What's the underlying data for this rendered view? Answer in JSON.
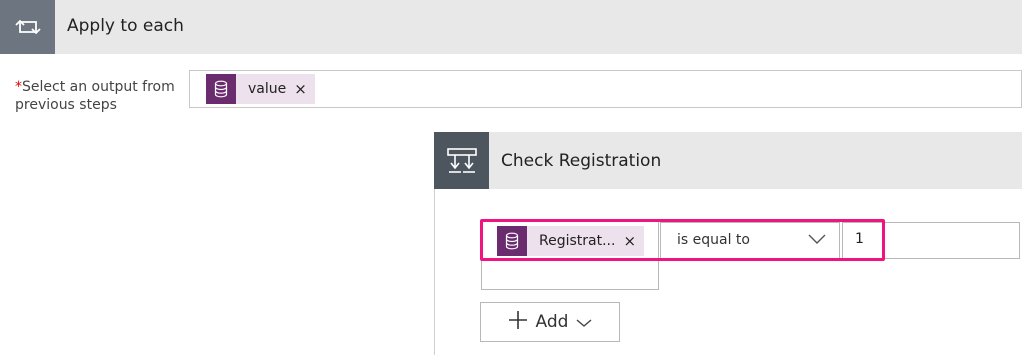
{
  "apply_to_each": {
    "title": "Apply to each",
    "icon": "loop-icon"
  },
  "output": {
    "required_mark": "*",
    "label": "Select an output from previous steps",
    "token": {
      "label": "value",
      "remove": "×",
      "icon": "database-icon",
      "color": "#6a2b6f"
    }
  },
  "condition": {
    "title": "Check Registration",
    "icon": "condition-icon",
    "left_token": {
      "label": "Registrat...",
      "remove": "×",
      "icon": "database-icon"
    },
    "operator": "is equal to",
    "right_value": "1",
    "highlight_color": "#f0147f",
    "add_button": {
      "label": "Add"
    }
  }
}
